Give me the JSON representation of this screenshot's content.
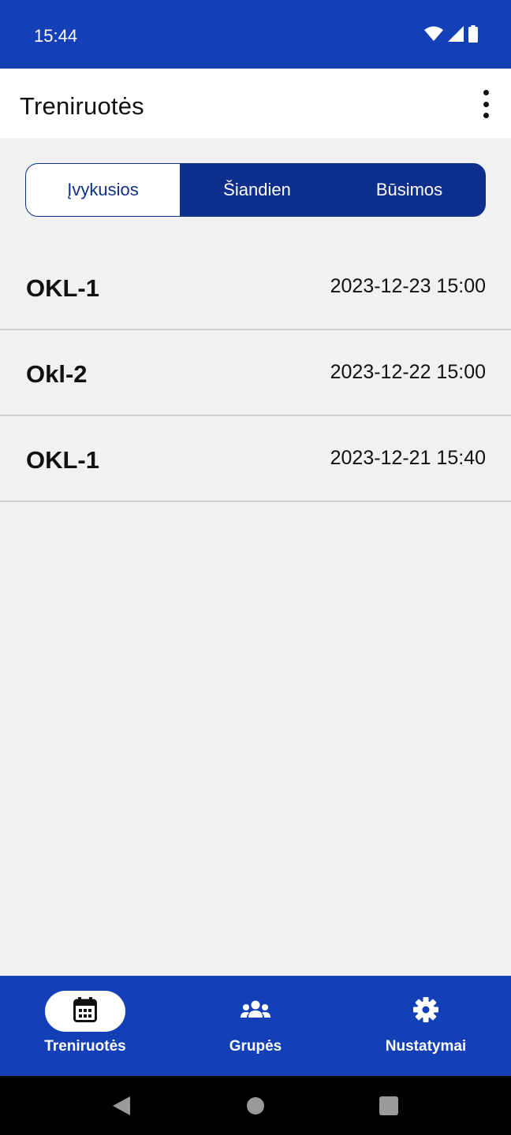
{
  "status_bar": {
    "time": "15:44",
    "icons": [
      "wifi-icon",
      "signal-icon",
      "battery-icon"
    ]
  },
  "app_bar": {
    "title": "Treniruotės",
    "menu_icon": "more-vertical-icon"
  },
  "tabs": [
    {
      "label": "Įvykusios",
      "active": true
    },
    {
      "label": "Šiandien",
      "active": false
    },
    {
      "label": "Būsimos",
      "active": false
    }
  ],
  "sessions": [
    {
      "title": "OKL-1",
      "datetime": "2023-12-23 15:00"
    },
    {
      "title": "Okl-2",
      "datetime": "2023-12-22 15:00"
    },
    {
      "title": "OKL-1",
      "datetime": "2023-12-21 15:40"
    }
  ],
  "bottom_nav": [
    {
      "label": "Treniruotės",
      "icon": "calendar-icon",
      "active": true
    },
    {
      "label": "Grupės",
      "icon": "groups-icon",
      "active": false
    },
    {
      "label": "Nustatymai",
      "icon": "gear-icon",
      "active": false
    }
  ],
  "system_nav": [
    "back-icon",
    "home-icon",
    "recents-icon"
  ],
  "colors": {
    "primary": "#1340b7",
    "tab_dark": "#0e2f8c",
    "background": "#f1f1f1",
    "divider": "#cfcfcf"
  }
}
